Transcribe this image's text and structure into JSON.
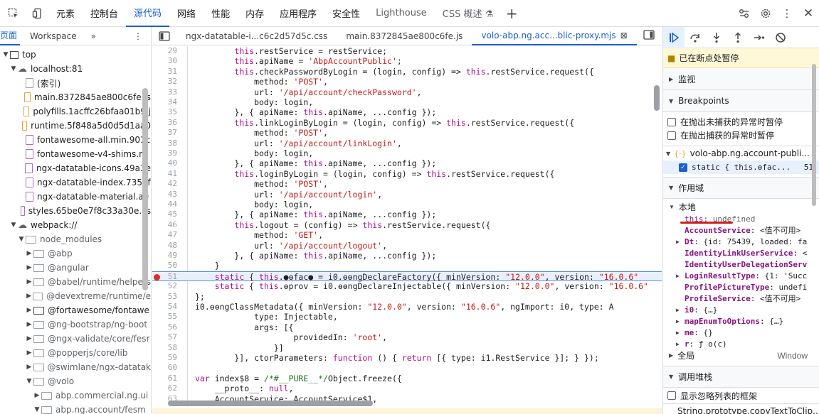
{
  "toolbar": {
    "tabs": [
      "元素",
      "控制台",
      "源代码",
      "网络",
      "性能",
      "内存",
      "应用程序",
      "安全性",
      "Lighthouse",
      "CSS 概述 ⚗"
    ],
    "active_tab": "源代码"
  },
  "left": {
    "tab1": "页面",
    "tab2": "Workspace",
    "items": [
      {
        "label": "top",
        "kind": "frame",
        "level": 0,
        "arrow": "▼"
      },
      {
        "label": "localhost:81",
        "kind": "cloud",
        "level": 1,
        "arrow": "▼"
      },
      {
        "label": "(索引)",
        "kind": "file-gray",
        "level": 2,
        "arrow": ""
      },
      {
        "label": "main.8372845ae800c6fe.js",
        "kind": "file",
        "level": 2,
        "arrow": ""
      },
      {
        "label": "polyfills.1acffc26bfaa01b9.j",
        "kind": "file",
        "level": 2,
        "arrow": ""
      },
      {
        "label": "runtime.5f848a5d0d5d1aa0",
        "kind": "file",
        "level": 2,
        "arrow": ""
      },
      {
        "label": "fontawesome-all.min.901c",
        "kind": "file-purple",
        "level": 2,
        "arrow": ""
      },
      {
        "label": "fontawesome-v4-shims.m",
        "kind": "file-purple",
        "level": 2,
        "arrow": ""
      },
      {
        "label": "ngx-datatable-icons.49a3e",
        "kind": "file-purple",
        "level": 2,
        "arrow": ""
      },
      {
        "label": "ngx-datatable-index.735ef",
        "kind": "file-purple",
        "level": 2,
        "arrow": ""
      },
      {
        "label": "ngx-datatable-material.a9",
        "kind": "file-purple",
        "level": 2,
        "arrow": ""
      },
      {
        "label": "styles.65be0e7f8c33a30e.cs",
        "kind": "file-purple",
        "level": 2,
        "arrow": ""
      },
      {
        "label": "webpack://",
        "kind": "cloud",
        "level": 1,
        "arrow": "▼"
      },
      {
        "label": "node_modules",
        "kind": "dir",
        "level": 2,
        "arrow": "▼",
        "gray": true
      },
      {
        "label": "@abp",
        "kind": "dir",
        "level": 3,
        "arrow": "▶",
        "gray": true
      },
      {
        "label": "@angular",
        "kind": "dir",
        "level": 3,
        "arrow": "▶",
        "gray": true
      },
      {
        "label": "@babel/runtime/helpers",
        "kind": "dir",
        "level": 3,
        "arrow": "▶",
        "gray": true
      },
      {
        "label": "@devextreme/runtime/e",
        "kind": "dir",
        "level": 3,
        "arrow": "▶",
        "gray": true
      },
      {
        "label": "@fortawesome/fontawe",
        "kind": "dir-dark",
        "level": 3,
        "arrow": "▶",
        "gray": false
      },
      {
        "label": "@ng-bootstrap/ng-boot",
        "kind": "dir",
        "level": 3,
        "arrow": "▶",
        "gray": true
      },
      {
        "label": "@ngx-validate/core/fesr",
        "kind": "dir",
        "level": 3,
        "arrow": "▶",
        "gray": true
      },
      {
        "label": "@popperjs/core/lib",
        "kind": "dir",
        "level": 3,
        "arrow": "▶",
        "gray": true
      },
      {
        "label": "@swimlane/ngx-datatak",
        "kind": "dir",
        "level": 3,
        "arrow": "▶",
        "gray": true
      },
      {
        "label": "@volo",
        "kind": "dir",
        "level": 3,
        "arrow": "▼",
        "gray": true
      },
      {
        "label": "abp.commercial.ng.ui",
        "kind": "dir",
        "level": 4,
        "arrow": "▶",
        "gray": true
      },
      {
        "label": "abp.ng.account/fesm",
        "kind": "dir",
        "level": 4,
        "arrow": "▼",
        "gray": true
      }
    ]
  },
  "editor": {
    "tabs": [
      {
        "label": "ngx-datatable-i...c6c2d57d5c.css",
        "active": false
      },
      {
        "label": "main.8372845ae800c6fe.js",
        "active": false
      },
      {
        "label": "volo-abp.ng.acc...blic-proxy.mjs",
        "active": true
      }
    ],
    "lines": [
      {
        "n": "29",
        "t": "        this.restService = restService;"
      },
      {
        "n": "30",
        "t": "        this.apiName = 'AbpAccountPublic';"
      },
      {
        "n": "31",
        "t": "        this.checkPasswordByLogin = (login, config) => this.restService.request({"
      },
      {
        "n": "32",
        "t": "            method: 'POST',"
      },
      {
        "n": "33",
        "t": "            url: '/api/account/checkPassword',"
      },
      {
        "n": "34",
        "t": "            body: login,"
      },
      {
        "n": "35",
        "t": "        }, { apiName: this.apiName, ...config });"
      },
      {
        "n": "36",
        "t": "        this.linkLoginByLogin = (login, config) => this.restService.request({"
      },
      {
        "n": "37",
        "t": "            method: 'POST',"
      },
      {
        "n": "38",
        "t": "            url: '/api/account/linkLogin',"
      },
      {
        "n": "39",
        "t": "            body: login,"
      },
      {
        "n": "40",
        "t": "        }, { apiName: this.apiName, ...config });"
      },
      {
        "n": "41",
        "t": "        this.loginByLogin = (login, config) => this.restService.request({"
      },
      {
        "n": "42",
        "t": "            method: 'POST',"
      },
      {
        "n": "43",
        "t": "            url: '/api/account/login',"
      },
      {
        "n": "44",
        "t": "            body: login,"
      },
      {
        "n": "45",
        "t": "        }, { apiName: this.apiName, ...config });"
      },
      {
        "n": "46",
        "t": "        this.logout = (config) => this.restService.request({"
      },
      {
        "n": "47",
        "t": "            method: 'GET',"
      },
      {
        "n": "48",
        "t": "            url: '/api/account/logout',"
      },
      {
        "n": "49",
        "t": "        }, { apiName: this.apiName, ...config });"
      },
      {
        "n": "50",
        "t": "    }"
      },
      {
        "n": "51",
        "t": "    static { this.●ɵfac● = i0.ɵɵngDeclareFactory({ minVersion: \"12.0.0\", version: \"16.0.6\""
      },
      {
        "n": "52",
        "t": "    static { this.ɵprov = i0.ɵɵngDeclareInjectable({ minVersion: \"12.0.0\", version: \"16.0.6\""
      },
      {
        "n": "53",
        "t": "};"
      },
      {
        "n": "54",
        "t": "i0.ɵɵngClassMetadata({ minVersion: \"12.0.0\", version: \"16.0.6\", ngImport: i0, type: A"
      },
      {
        "n": "55",
        "t": "            type: Injectable,"
      },
      {
        "n": "56",
        "t": "            args: [{"
      },
      {
        "n": "57",
        "t": "                    providedIn: 'root',"
      },
      {
        "n": "58",
        "t": "                }]"
      },
      {
        "n": "59",
        "t": "        }], ctorParameters: function () { return [{ type: i1.RestService }]; } });"
      },
      {
        "n": "60",
        "t": ""
      },
      {
        "n": "61",
        "t": "var index$8 = /*#__PURE__*/Object.freeze({"
      },
      {
        "n": "62",
        "t": "    __proto__: null,"
      },
      {
        "n": "63",
        "t": "    AccountService: AccountService$1,"
      }
    ]
  },
  "debugger": {
    "paused": "已在断点处暂停",
    "watch": "监视",
    "breakpoints": "Breakpoints",
    "pause_uncaught": "在抛出未捕获的异常时暂停",
    "pause_caught": "在抛出捕获的异常时暂停",
    "bp_file": "volo-abp.ng.account-publi...",
    "bp_code": "static { this.ɵfac...",
    "bp_line": "51",
    "scope": "作用域",
    "local": "本地",
    "scope_rows": [
      {
        "arrow": "",
        "k": "this",
        "v": ": undefined",
        "indent": 1,
        "gray": true
      },
      {
        "arrow": "",
        "k": "AccountService",
        "v": ": <值不可用>",
        "indent": 1
      },
      {
        "arrow": "▶",
        "k": "Dt",
        "v": ": {id: 75439, loaded: fa",
        "indent": 1
      },
      {
        "arrow": "",
        "k": "IdentityLinkUserService",
        "v": ": <",
        "indent": 1
      },
      {
        "arrow": "",
        "k": "IdentityUserDelegationServ",
        "v": "",
        "indent": 1
      },
      {
        "arrow": "▶",
        "k": "LoginResultType",
        "v": ": {1: 'Succ",
        "indent": 1
      },
      {
        "arrow": "",
        "k": "ProfilePictureType",
        "v": ": undefi",
        "indent": 1
      },
      {
        "arrow": "",
        "k": "ProfileService",
        "v": ": <值不可用>",
        "indent": 1
      },
      {
        "arrow": "▶",
        "k": "i0",
        "v": ": {…}",
        "indent": 1
      },
      {
        "arrow": "▶",
        "k": "mapEnumToOptions",
        "v": ": {…}",
        "indent": 1
      },
      {
        "arrow": "▶",
        "k": "me",
        "v": ": {}",
        "indent": 1
      },
      {
        "arrow": "▶",
        "k": "r",
        "v": ": ƒ o(c)",
        "indent": 1
      }
    ],
    "global": "全局",
    "global_val": "Window",
    "callstack": "调用堆栈",
    "show_ignored": "显示忽略列表的框架",
    "frame": "String.prototype.copyTextToClip..."
  }
}
